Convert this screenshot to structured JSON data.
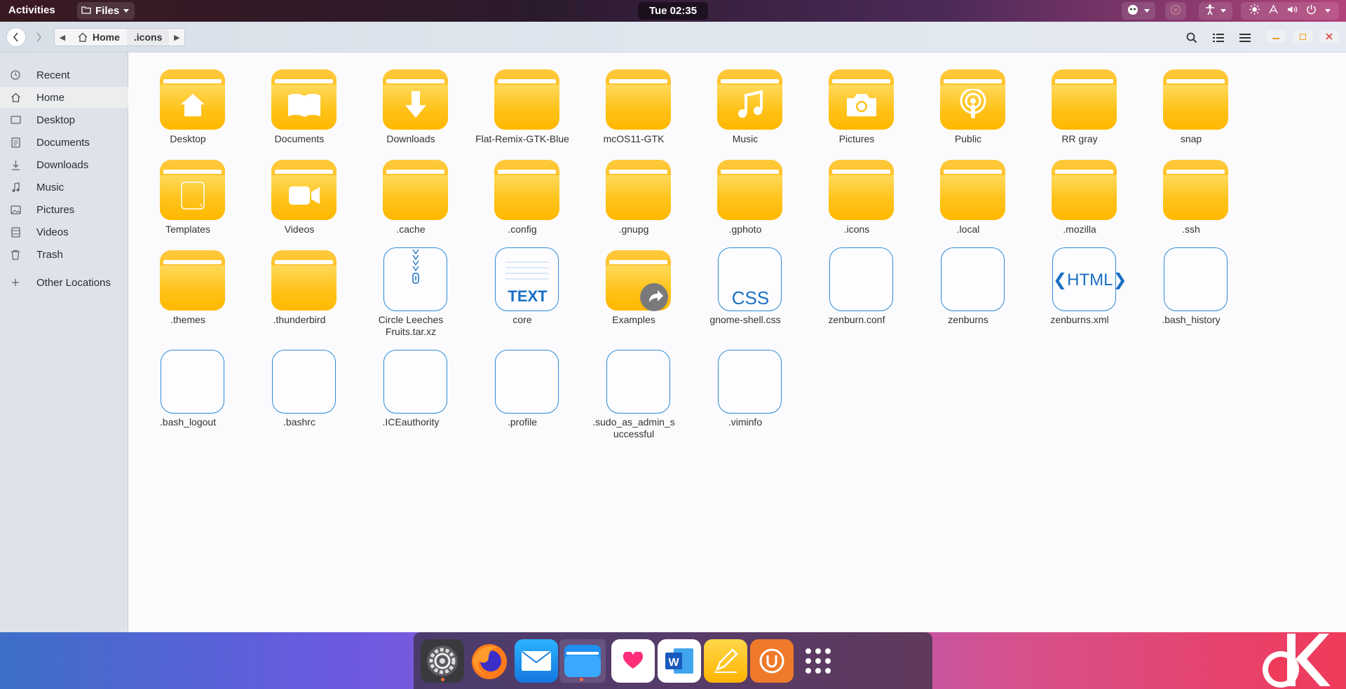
{
  "topbar": {
    "activities": "Activities",
    "app_menu": "Files",
    "clock": "Tue 02:35"
  },
  "headerbar": {
    "path": [
      "Home",
      ".icons"
    ]
  },
  "sidebar": {
    "items": [
      {
        "label": "Recent",
        "icon": "clock-icon"
      },
      {
        "label": "Home",
        "icon": "home-icon",
        "active": true
      },
      {
        "label": "Desktop",
        "icon": "desktop-icon"
      },
      {
        "label": "Documents",
        "icon": "document-icon"
      },
      {
        "label": "Downloads",
        "icon": "download-icon"
      },
      {
        "label": "Music",
        "icon": "music-icon"
      },
      {
        "label": "Pictures",
        "icon": "picture-icon"
      },
      {
        "label": "Videos",
        "icon": "video-icon"
      },
      {
        "label": "Trash",
        "icon": "trash-icon"
      },
      {
        "label": "Other Locations",
        "icon": "plus-icon"
      }
    ]
  },
  "files": {
    "row1": [
      "Desktop",
      "Documents",
      "Downloads",
      "Flat-Remix-GTK-Blue",
      "mcOS11-GTK",
      "Music",
      "Pictures",
      "Public",
      "RR gray",
      "snap"
    ],
    "row2": [
      "Templates",
      "Videos",
      ".cache",
      ".config",
      ".gnupg",
      ".gphoto",
      ".icons",
      ".local",
      ".mozilla",
      ".ssh"
    ],
    "row3": [
      ".themes",
      ".thunderbird",
      "Circle Leeches Fruits.tar.xz",
      "core",
      "Examples",
      "gnome-shell.css",
      "zenburn.conf",
      "zenburns",
      "zenburns.xml",
      ".bash_history"
    ],
    "row4": [
      ".bash_logout",
      ".bashrc",
      ".ICEauthority",
      ".profile",
      ".sudo_as_admin_successful",
      ".viminfo"
    ],
    "labels": {
      "text": "TEXT",
      "css": "CSS",
      "html": "❮HTML❯"
    }
  },
  "dock": {
    "apps": [
      "settings",
      "firefox",
      "mail",
      "files",
      "health",
      "word",
      "notes",
      "updater",
      "app-grid"
    ]
  },
  "colors": {
    "folder": "#ffc21a",
    "accent": "#2b8ad8"
  }
}
